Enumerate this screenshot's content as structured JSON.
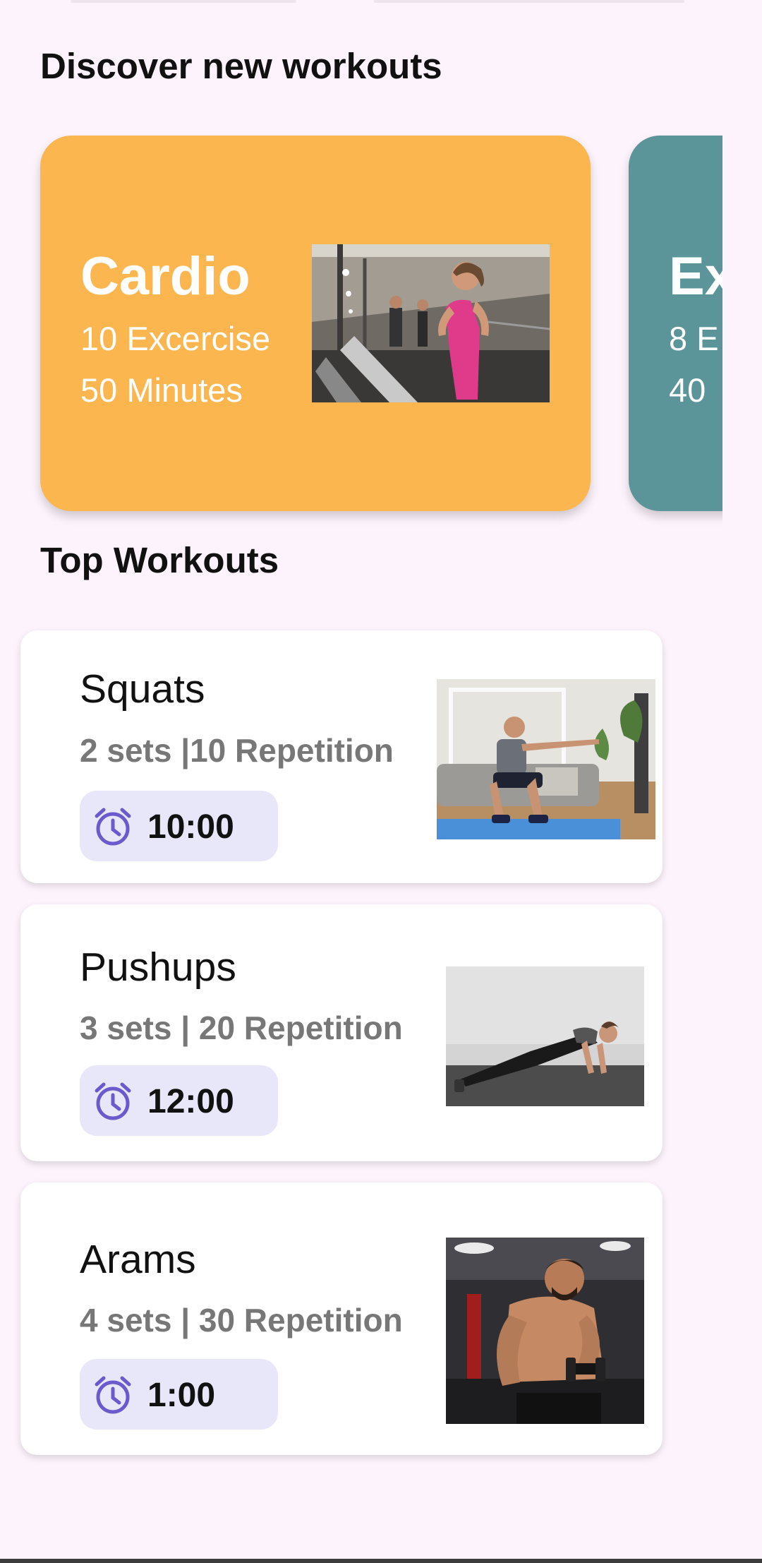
{
  "discover": {
    "title": "Discover new workouts",
    "categories": [
      {
        "name": "Cardio",
        "exercises": "10 Excercise",
        "duration": "50 Minutes",
        "color": "#fbb64f",
        "image": "woman-running-treadmill-photo"
      },
      {
        "name": "Ex",
        "exercises": "8 E",
        "duration": "40",
        "color": "#5b9599"
      }
    ]
  },
  "top": {
    "title": "Top Workouts",
    "workouts": [
      {
        "name": "Squats",
        "meta": "2 sets |10 Repetition",
        "time": "10:00",
        "image": "man-squatting-photo"
      },
      {
        "name": "Pushups",
        "meta": "3 sets | 20 Repetition",
        "time": "12:00",
        "image": "woman-pushup-photo"
      },
      {
        "name": "Arams",
        "meta": "4 sets | 30 Repetition",
        "time": "1:00",
        "image": "man-dumbbell-curl-photo"
      }
    ]
  },
  "colors": {
    "background": "#fdf3fc",
    "pill": "#e8e7f9",
    "clock_icon": "#6a5acd",
    "meta_text": "#777777"
  }
}
